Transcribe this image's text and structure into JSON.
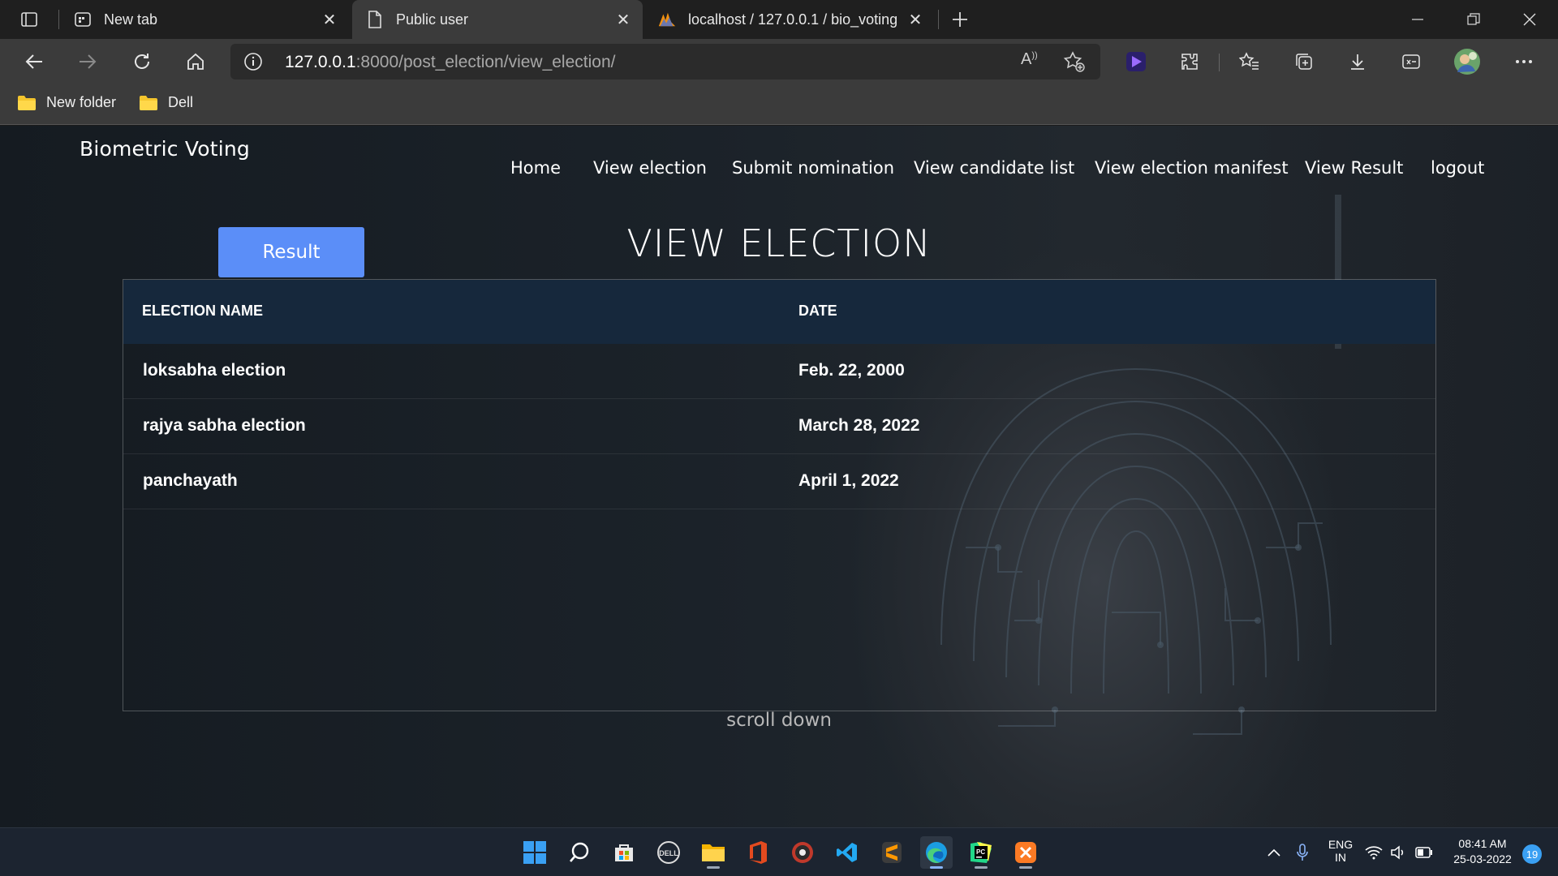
{
  "browser": {
    "tabs": [
      {
        "title": "New tab",
        "icon": "new-tab-icon",
        "active": false
      },
      {
        "title": "Public user",
        "icon": "page-icon",
        "active": true
      },
      {
        "title": "localhost / 127.0.0.1 / bio_voting",
        "icon": "phpmyadmin-icon",
        "active": false
      }
    ],
    "address": {
      "host": "127.0.0.1",
      "rest": ":8000/post_election/view_election/"
    },
    "bookmarks": [
      {
        "label": "New folder",
        "icon": "folder-icon"
      },
      {
        "label": "Dell",
        "icon": "folder-icon"
      }
    ]
  },
  "site": {
    "brand": "Biometric Voting",
    "nav": [
      "Home",
      "View election",
      "Submit nomination",
      "View candidate list",
      "View election manifest",
      "View Result",
      "logout"
    ],
    "result_button": "Result",
    "title": "VIEW ELECTION",
    "table": {
      "headers": [
        "ELECTION NAME",
        "DATE"
      ],
      "rows": [
        [
          "loksabha election",
          "Feb. 22, 2000"
        ],
        [
          "rajya sabha election",
          "March 28, 2022"
        ],
        [
          "panchayath",
          "April 1, 2022"
        ]
      ]
    },
    "scroll_hint": "scroll down"
  },
  "taskbar": {
    "apps": [
      "windows-start-icon",
      "search-icon",
      "microsoft-store-icon",
      "dell-icon",
      "file-explorer-icon",
      "office-icon",
      "media-player-icon",
      "vscode-icon",
      "sublime-text-icon",
      "edge-icon",
      "pycharm-icon",
      "xampp-icon"
    ],
    "lang": "ENG",
    "region": "IN",
    "time": "08:41 AM",
    "date": "25-03-2022",
    "notifications": "19"
  },
  "colors": {
    "accent_button": "#5b8ef8",
    "table_header": "#16283c"
  }
}
